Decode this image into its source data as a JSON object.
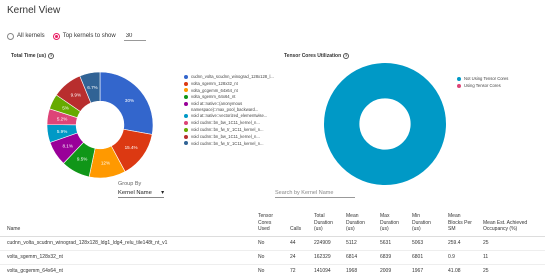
{
  "page_title": "Kernel View",
  "filter": {
    "all_label": "All kernels",
    "top_label": "Top kernels to show",
    "top_value": "30"
  },
  "total_time_chart": {
    "title": "Total Time (us)",
    "help": "?",
    "legend": [
      {
        "label": "cudnn_volta_scudnn_winograd_128x128_l...",
        "color": "#3366cc"
      },
      {
        "label": "volta_sgemm_128x32_nt",
        "color": "#dc3912"
      },
      {
        "label": "volta_gcgemm_64x64_nt",
        "color": "#ff9900"
      },
      {
        "label": "volta_sgemm_64x64_nt",
        "color": "#109618"
      },
      {
        "label": "void at::native::(anonymous namespace)::max_pool_backward...",
        "color": "#990099"
      },
      {
        "label": "void at::native::vectorized_elementwise...",
        "color": "#0099c6"
      },
      {
        "label": "void cudnn::bn_bw_1C11_kernel_n...",
        "color": "#dd4477"
      },
      {
        "label": "void cudnn::bn_fw_tr_1C11_kernel_n...",
        "color": "#66aa00"
      },
      {
        "label": "void cudnn::bn_bw_1C11_kernel_n...",
        "color": "#b82e2e"
      },
      {
        "label": "void cudnn::bn_fw_tr_1C11_kernel_n...",
        "color": "#316395"
      }
    ]
  },
  "tensor_cores_chart": {
    "title": "Tensor Cores Utilization",
    "help": "?",
    "legend": [
      {
        "label": "Not Using Tensor Cores",
        "color": "#0099c6"
      },
      {
        "label": "Using Tensor Cores",
        "color": "#dd4477"
      }
    ]
  },
  "chart_data": [
    {
      "type": "pie",
      "title": "Total Time (us)",
      "donut": true,
      "slices": [
        {
          "label": "cudnn_volta_scudnn_winograd_128x128_l...",
          "value": 30,
          "text": "30%",
          "color": "#3366cc"
        },
        {
          "label": "volta_sgemm_128x32_nt",
          "value": 15.4,
          "text": "15.4%",
          "color": "#dc3912"
        },
        {
          "label": "volta_gcgemm_64x64_nt",
          "value": 12,
          "text": "12%",
          "color": "#ff9900"
        },
        {
          "label": "volta_sgemm_64x64_nt",
          "value": 9.5,
          "text": "9.5%",
          "color": "#109618"
        },
        {
          "label": "void at::native::(anonymous namespace)::max_pool_backward...",
          "value": 8.1,
          "text": "8.1%",
          "color": "#990099"
        },
        {
          "label": "void at::native::vectorized_elementwise...",
          "value": 5.9,
          "text": "5.9%",
          "color": "#0099c6"
        },
        {
          "label": "void cudnn::bn_bw_1C11_kernel_n...",
          "value": 5.2,
          "text": "5.2%",
          "color": "#dd4477"
        },
        {
          "label": "void cudnn::bn_fw_tr_1C11_kernel_n...",
          "value": 5,
          "text": "5%",
          "color": "#66aa00"
        },
        {
          "label": "void cudnn::bn_bw_1C11_kernel_n...",
          "value": 9.9,
          "text": "9.9%",
          "color": "#b82e2e"
        },
        {
          "label": "void cudnn::bn_fw_tr_1C11_kernel_n...",
          "value": 6.7,
          "text": "6.7%",
          "color": "#316395"
        }
      ]
    },
    {
      "type": "pie",
      "title": "Tensor Cores Utilization",
      "donut": true,
      "slices": [
        {
          "label": "Not Using Tensor Cores",
          "value": 100,
          "text": "",
          "color": "#0099c6"
        },
        {
          "label": "Using Tensor Cores",
          "value": 0,
          "text": "",
          "color": "#dd4477"
        }
      ]
    }
  ],
  "group_by": {
    "label": "Group By",
    "value": "Kernel Name"
  },
  "search": {
    "placeholder": "Search by Kernel Name"
  },
  "table": {
    "columns": [
      "Name",
      "Tensor Cores Used",
      "Calls",
      "Total Duration (us)",
      "Mean Duration (us)",
      "Max Duration (us)",
      "Min Duration (us)",
      "Mean Blocks Per SM",
      "Mean Est. Achieved Occupancy (%)"
    ],
    "rows": [
      [
        "cudnn_volta_scudnn_winograd_128x128_ldg1_ldg4_relu_tile148t_nt_v1",
        "No",
        "44",
        "224909",
        "5112",
        "5631",
        "5063",
        "259.4",
        "25"
      ],
      [
        "volta_sgemm_128x32_nt",
        "No",
        "24",
        "162329",
        "6814",
        "6839",
        "6801",
        "0.9",
        "11"
      ],
      [
        "volta_gcgemm_64x64_nt",
        "No",
        "72",
        "141094",
        "1968",
        "2009",
        "1967",
        "41.08",
        "25"
      ]
    ]
  }
}
